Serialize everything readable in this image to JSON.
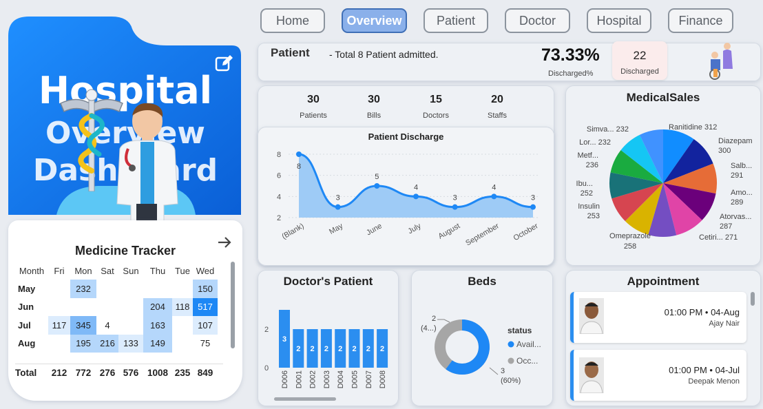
{
  "nav": [
    "Home",
    "Overview",
    "Patient",
    "Doctor",
    "Hospital",
    "Finance"
  ],
  "hero": {
    "line1": "Hospital",
    "line2": "Overview",
    "line3": "Dashboard"
  },
  "patient_bar": {
    "label": "Patient",
    "text": "- Total 8 Patient admitted.",
    "pct": "73.33%",
    "pct_label": "Discharged%",
    "count": "22",
    "count_label": "Discharged"
  },
  "stats": [
    {
      "value": "30",
      "label": "Patients"
    },
    {
      "value": "30",
      "label": "Bills"
    },
    {
      "value": "15",
      "label": "Doctors"
    },
    {
      "value": "20",
      "label": "Staffs"
    }
  ],
  "medicine": {
    "title": "Medicine Tracker",
    "headers": [
      "Month",
      "Fri",
      "Mon",
      "Sat",
      "Sun",
      "Thu",
      "Tue",
      "Wed"
    ],
    "rows": [
      [
        "May",
        "",
        "232",
        "",
        "",
        "",
        "",
        "150"
      ],
      [
        "Jun",
        "",
        "",
        "",
        "",
        "204",
        "118",
        "517"
      ],
      [
        "Jul",
        "117",
        "345",
        "4",
        "",
        "163",
        "",
        "107"
      ],
      [
        "Aug",
        "",
        "195",
        "216",
        "133",
        "149",
        "",
        "75"
      ]
    ],
    "total": [
      "Total",
      "212",
      "772",
      "276",
      "576",
      "1008",
      "235",
      "849"
    ]
  },
  "chart_data": [
    {
      "type": "area",
      "title": "Patient Discharge",
      "categories": [
        "(Blank)",
        "May",
        "June",
        "July",
        "August",
        "September",
        "October"
      ],
      "values": [
        8,
        3,
        5,
        4,
        3,
        4,
        3
      ],
      "ylim": [
        2,
        8
      ],
      "yticks": [
        2,
        4,
        6,
        8
      ]
    },
    {
      "type": "pie",
      "title": "MedicalSales",
      "labels": [
        "Ranitidine",
        "Diazepam",
        "Salb...",
        "Amo...",
        "Atorvas...",
        "Cetiri...",
        "Omeprazole",
        "Insulin",
        "Ibu...",
        "Metf...",
        "Lor...",
        "Simva..."
      ],
      "values": [
        312,
        300,
        291,
        289,
        287,
        271,
        258,
        253,
        252,
        236,
        232,
        232
      ],
      "colors": [
        "#118dff",
        "#12239e",
        "#e66c37",
        "#6b007b",
        "#e044a7",
        "#744ec2",
        "#d9b300",
        "#d64550",
        "#197278",
        "#1aab40",
        "#15c6f4",
        "#4092ff",
        "#f99e4f",
        "#a66999",
        "#bf56c4",
        "#ef67c2"
      ]
    },
    {
      "type": "bar",
      "title": "Doctor's Patient",
      "categories": [
        "D006",
        "D001",
        "D002",
        "D003",
        "D004",
        "D005",
        "D007",
        "D008"
      ],
      "values": [
        3,
        2,
        2,
        2,
        2,
        2,
        2,
        2
      ],
      "yticks": [
        0,
        2
      ]
    },
    {
      "type": "pie",
      "title": "Beds",
      "legend_title": "status",
      "labels": [
        "Avail...",
        "Occ..."
      ],
      "values": [
        3,
        2
      ],
      "data_labels": [
        "3\n(60%)",
        "2\n(4...)"
      ],
      "colors": [
        "#1e88f5",
        "#a6a6a6"
      ]
    }
  ],
  "appointment": {
    "title": "Appointment",
    "items": [
      {
        "time": "01:00 PM • 04-Aug",
        "name": "Ajay Nair"
      },
      {
        "time": "01:00 PM • 04-Jul",
        "name": "Deepak Menon"
      }
    ]
  }
}
